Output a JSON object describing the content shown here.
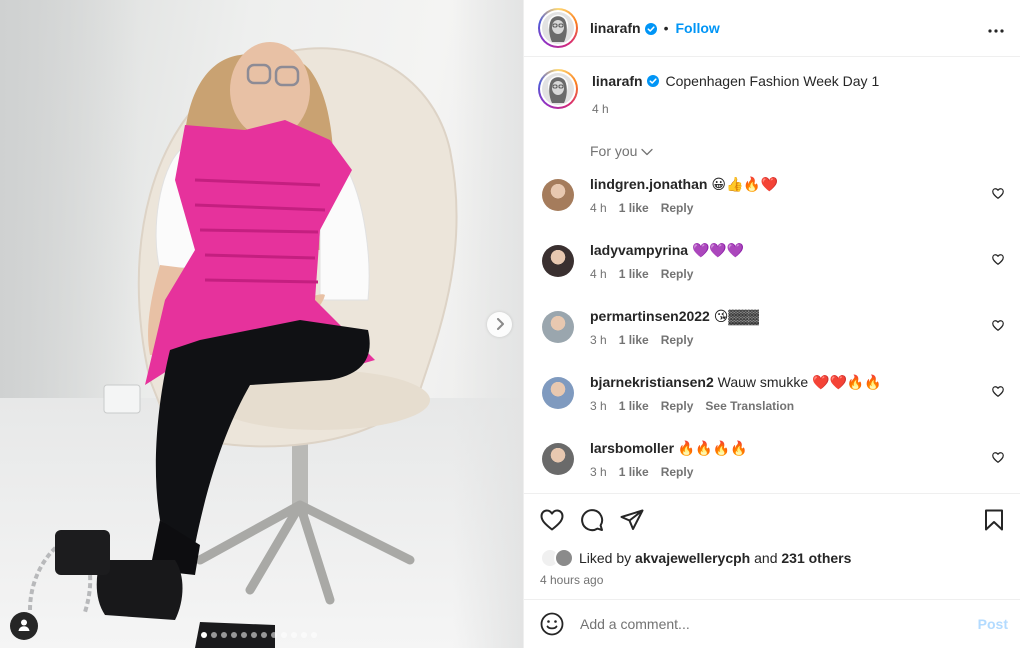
{
  "header": {
    "username": "linarafn",
    "separator": "•",
    "follow_label": "Follow"
  },
  "caption": {
    "username": "linarafn",
    "text": "Copenhagen Fashion Week Day 1",
    "time": "4 h"
  },
  "sort_label": "For you",
  "comments": [
    {
      "username": "lindgren.jonathan",
      "text": "😀👍🔥❤️",
      "time": "4 h",
      "likes": "1 like",
      "reply": "Reply",
      "avatar_color": "#a57c5c"
    },
    {
      "username": "ladyvampyrina",
      "text": "💜💜💜",
      "time": "4 h",
      "likes": "1 like",
      "reply": "Reply",
      "avatar_color": "#3a3030"
    },
    {
      "username": "permartinsen2022",
      "text": "😘▓▓▓",
      "time": "3 h",
      "likes": "1 like",
      "reply": "Reply",
      "avatar_color": "#9aa6ae"
    },
    {
      "username": "bjarnekristiansen2",
      "text": "Wauw smukke ❤️❤️🔥🔥",
      "time": "3 h",
      "likes": "1 like",
      "reply": "Reply",
      "see_translation": "See Translation",
      "avatar_color": "#7f9abf"
    },
    {
      "username": "larsbomoller",
      "text": "🔥🔥🔥🔥",
      "time": "3 h",
      "likes": "1 like",
      "reply": "Reply",
      "avatar_color": "#6a6a6a"
    }
  ],
  "likes": {
    "prefix": "Liked by",
    "liker": "akvajewellerycph",
    "middle": "and",
    "others": "231 others"
  },
  "posted_time": "4 hours ago",
  "add_comment": {
    "placeholder": "Add a comment...",
    "post_label": "Post"
  },
  "carousel": {
    "slide_count": 12,
    "active_index": 0
  },
  "colors": {
    "accent_blue": "#0095f6",
    "post_disabled": "#b3dbff",
    "vest_pink": "#e6329c",
    "text": "#262626",
    "muted": "#737373"
  }
}
